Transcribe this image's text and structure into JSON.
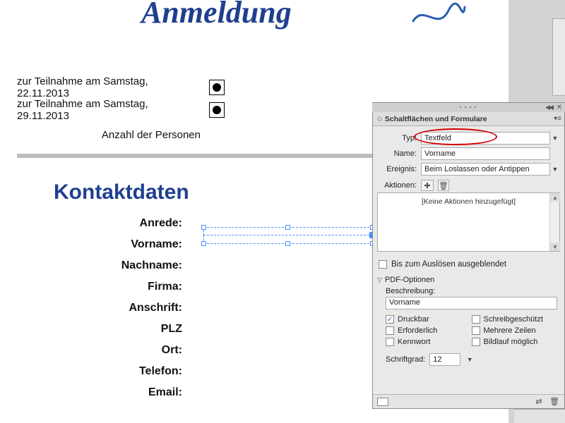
{
  "doc": {
    "title": "Anmeldung",
    "event1": "zur Teilnahme am Samstag, 22.11.2013",
    "event2": "zur Teilnahme am Samstag, 29.11.2013",
    "persons": "Anzahl der Personen",
    "contact_heading": "Kontaktdaten",
    "fields": {
      "anrede": "Anrede:",
      "vorname": "Vorname:",
      "nachname": "Nachname:",
      "firma": "Firma:",
      "anschrift": "Anschrift:",
      "plz": "PLZ",
      "ort": "Ort:",
      "telefon": "Telefon:",
      "email": "Email:"
    }
  },
  "panel": {
    "title": "Schaltflächen und Formulare",
    "typ_label": "Typ:",
    "typ_value": "Textfeld",
    "name_label": "Name:",
    "name_value": "Vorname",
    "ereignis_label": "Ereignis:",
    "ereignis_value": "Beim Loslassen oder Antippen",
    "aktionen_label": "Aktionen:",
    "no_actions": "[Keine Aktionen hinzugefügt]",
    "hidden_until_trigger": "Bis zum Auslösen ausgeblendet",
    "pdf_section": "PDF-Optionen",
    "beschreibung_label": "Beschreibung:",
    "beschreibung_value": "Vorname",
    "druckbar": "Druckbar",
    "erforderlich": "Erforderlich",
    "kennwort": "Kennwort",
    "schreibgeschuetzt": "Schreibgeschützt",
    "mehrere_zeilen": "Mehrere Zeilen",
    "bildlauf": "Bildlauf möglich",
    "schriftgrad_label": "Schriftgrad:",
    "schriftgrad_value": "12"
  }
}
